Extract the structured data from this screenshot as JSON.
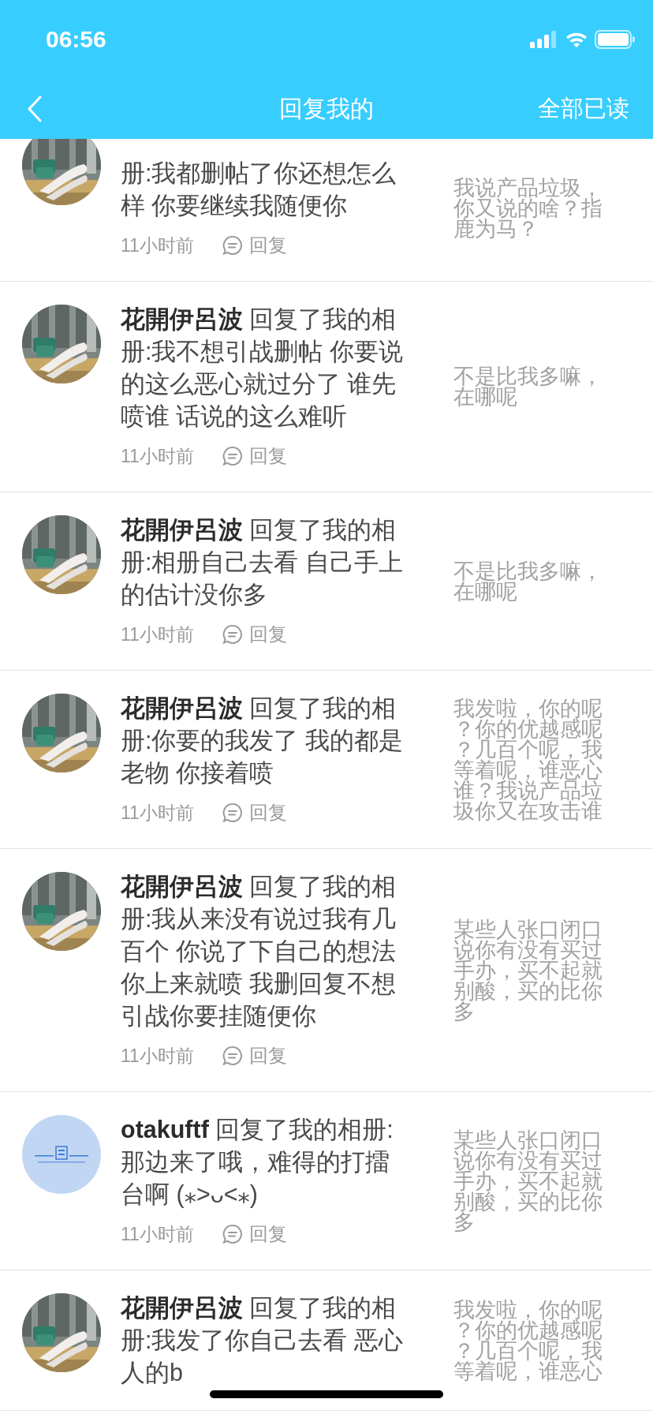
{
  "status_bar": {
    "time": "06:56"
  },
  "nav": {
    "title": "回复我的",
    "action": "全部已读"
  },
  "replies": [
    {
      "text": "册:我都删帖了你还想怎么样 你要继续我随便你",
      "time": "11小时前",
      "reply": "回复",
      "quote": "我说产品垃圾，你又说的啥？指鹿为马？"
    },
    {
      "text": "**花開伊呂波** 回复了我的相册:我不想引战删帖 你要说的这么恶心就过分了 谁先喷谁 话说的这么难听",
      "time": "11小时前",
      "reply": "回复",
      "quote": "不是比我多嘛，在哪呢"
    },
    {
      "text": "**花開伊呂波** 回复了我的相册:相册自己去看 自己手上的估计没你多",
      "time": "11小时前",
      "reply": "回复",
      "quote": "不是比我多嘛，在哪呢"
    },
    {
      "text": "**花開伊呂波** 回复了我的相册:你要的我发了 我的都是老物 你接着喷",
      "time": "11小时前",
      "reply": "回复",
      "quote": "我发啦，你的呢？你的优越感呢？几百个呢，我等着呢，谁恶心谁？我说产品垃圾你又在攻击谁"
    },
    {
      "text": "**花開伊呂波** 回复了我的相册:我从来没有说过我有几百个 你说了下自己的想法你上来就喷 我删回复不想引战你要挂随便你",
      "time": "11小时前",
      "reply": "回复",
      "quote": "某些人张口闭口说你有没有买过手办，买不起就别酸，买的比你多"
    },
    {
      "kind": "logo",
      "text": "**otakuftf** 回复了我的相册:那边来了哦，难得的打擂台啊 (⁎˃ᴗ˂⁎)",
      "time": "11小时前",
      "reply": "回复",
      "quote": "某些人张口闭口说你有没有买过手办，买不起就别酸，买的比你多"
    },
    {
      "text": "**花開伊呂波** 回复了我的相册:我发了你自己去看 恶心人的b",
      "quote": "我发啦，你的呢？你的优越感呢？几百个呢，我等着呢，谁恶心"
    }
  ]
}
